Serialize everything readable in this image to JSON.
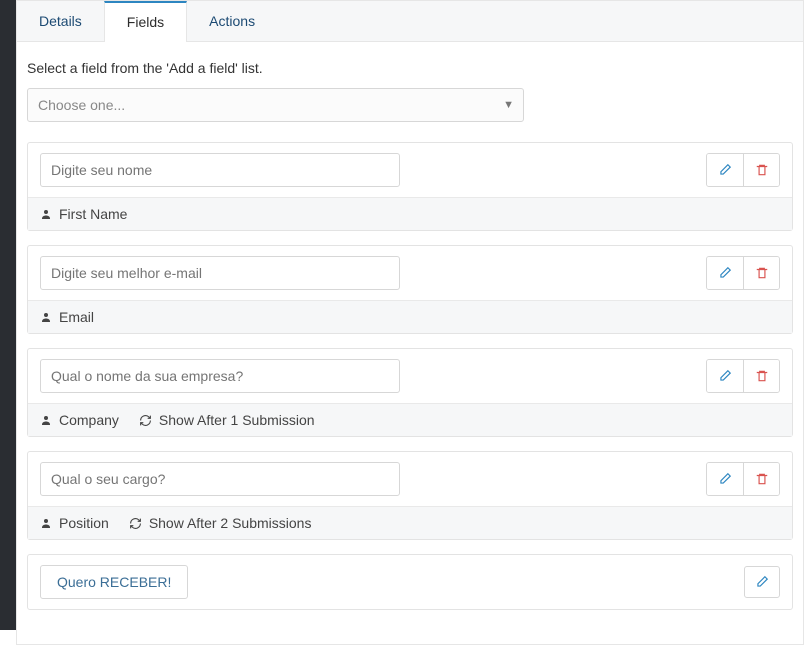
{
  "tabs": {
    "details": "Details",
    "fields": "Fields",
    "actions": "Actions"
  },
  "instruction": "Select a field from the 'Add a field' list.",
  "select_placeholder": "Choose one...",
  "fields": [
    {
      "placeholder": "Digite seu nome",
      "type_label": "First Name",
      "show_after": null
    },
    {
      "placeholder": "Digite seu melhor e-mail",
      "type_label": "Email",
      "show_after": null
    },
    {
      "placeholder": "Qual o nome da sua empresa?",
      "type_label": "Company",
      "show_after": "Show After 1 Submission"
    },
    {
      "placeholder": "Qual o seu cargo?",
      "type_label": "Position",
      "show_after": "Show After 2 Submissions"
    }
  ],
  "submit": {
    "label": "Quero RECEBER!"
  },
  "icons": {
    "edit": "edit",
    "delete": "delete",
    "user": "user",
    "refresh": "refresh"
  }
}
